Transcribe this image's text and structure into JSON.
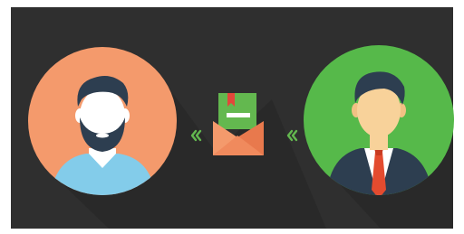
{
  "scene": {
    "colors": {
      "frame": "#ffffff",
      "background": "#2f2f2f",
      "left_circle": "#f49a6c",
      "right_circle": "#56b94a",
      "skin": "#ffffff",
      "skin_right": "#f8d29a",
      "hair": "#2d3e50",
      "shirt_left": "#83ccea",
      "suit_right": "#2d3e50",
      "shirt_right": "#ffffff",
      "tie": "#e34b2f",
      "envelope_body": "#f08a5d",
      "envelope_letter": "#63b84f",
      "envelope_ribbon": "#e2473a",
      "chevrons": "#63b84f"
    },
    "icons": [
      "man-with-beard-avatar-icon",
      "businessman-avatar-icon",
      "open-envelope-icon",
      "double-chevron-left-icon"
    ]
  }
}
